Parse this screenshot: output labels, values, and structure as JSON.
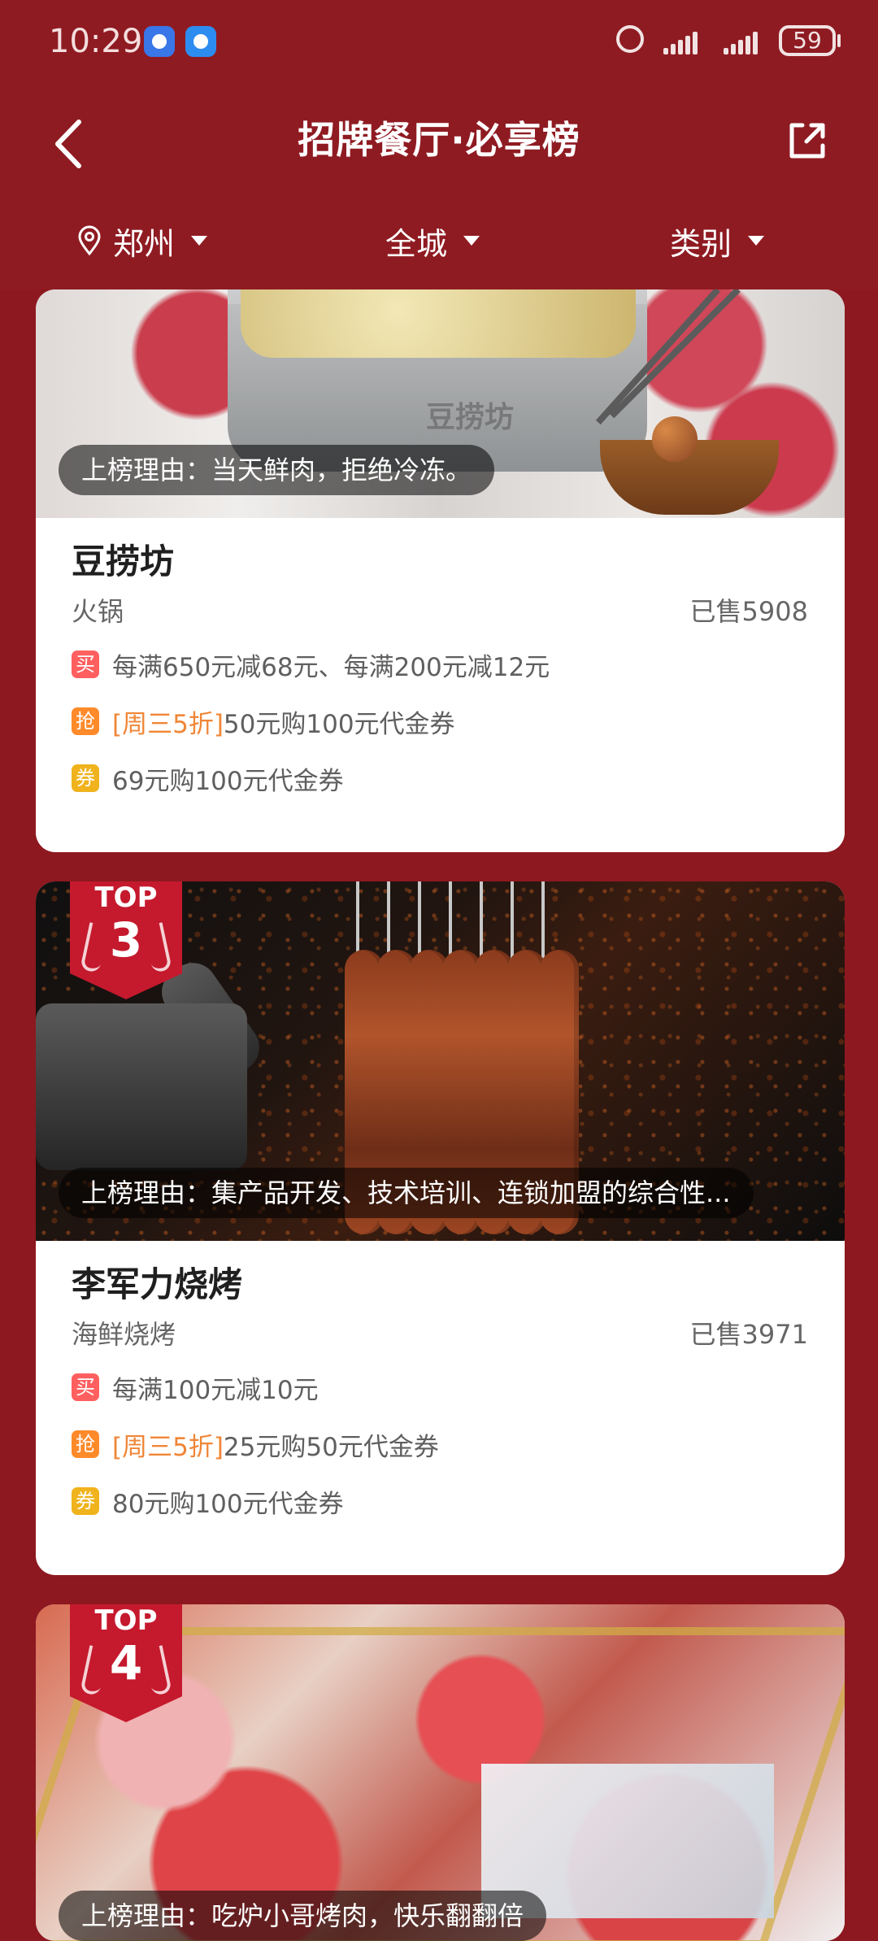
{
  "status": {
    "time": "10:29",
    "battery": "59"
  },
  "header": {
    "title": "招牌餐厅·必享榜"
  },
  "filters": {
    "city": "郑州",
    "scope": "全城",
    "category": "类别"
  },
  "cards": [
    {
      "reason": "上榜理由：当天鲜肉，拒绝冷冻。",
      "name": "豆捞坊",
      "type": "火锅",
      "sold": "已售5908",
      "image_label": "豆捞坊",
      "promos": [
        {
          "tag": "买",
          "text": "每满650元减68元、每满200元减12元"
        },
        {
          "tag": "抢",
          "highlight": "[周三5折]",
          "text": "50元购100元代金券"
        },
        {
          "tag": "券",
          "text": "69元购100元代金券"
        }
      ]
    },
    {
      "rank_label": "TOP",
      "rank": "3",
      "reason": "上榜理由：集产品开发、技术培训、连锁加盟的综合性...",
      "name": "李军力烧烤",
      "type": "海鲜烧烤",
      "sold": "已售3971",
      "promos": [
        {
          "tag": "买",
          "text": "每满100元减10元"
        },
        {
          "tag": "抢",
          "highlight": "[周三5折]",
          "text": "25元购50元代金券"
        },
        {
          "tag": "券",
          "text": "80元购100元代金券"
        }
      ]
    },
    {
      "rank_label": "TOP",
      "rank": "4",
      "reason": "上榜理由：吃炉小哥烤肉，快乐翻翻倍"
    }
  ]
}
